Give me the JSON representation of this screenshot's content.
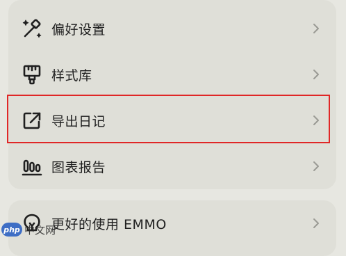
{
  "menu": {
    "items": [
      {
        "label": "偏好设置",
        "icon": "magic-wand-icon"
      },
      {
        "label": "样式库",
        "icon": "paint-brush-icon"
      },
      {
        "label": "导出日记",
        "icon": "export-icon"
      },
      {
        "label": "图表报告",
        "icon": "bar-chart-icon"
      }
    ]
  },
  "tips": {
    "label": "更好的使用 EMMO",
    "icon": "lightbulb-icon"
  },
  "watermark": {
    "logo": "php",
    "text": "中文网"
  },
  "colors": {
    "background": "#e7e7e1",
    "card": "#dfdfd8",
    "highlight": "#e02727",
    "chevron": "#9a9a94"
  }
}
